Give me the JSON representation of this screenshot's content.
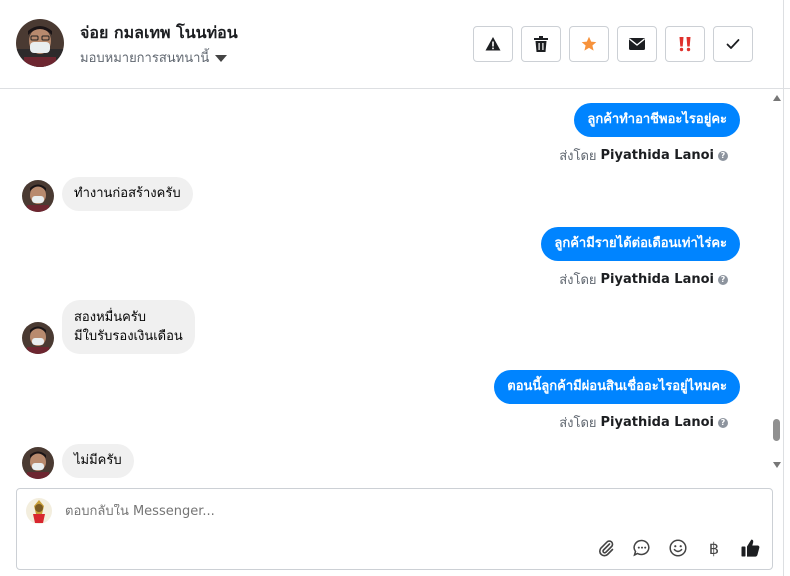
{
  "contact": {
    "name": "จ่อย กมลเทพ โนนท่อน",
    "assign_label": "มอบหมายการสนทนานี้"
  },
  "toolbar": [
    "alert-icon",
    "trash-icon",
    "star-icon",
    "envelope-icon",
    "important-icon",
    "check-icon"
  ],
  "colors": {
    "accent": "#0084ff",
    "star": "#f7923b",
    "important": "#e0312c"
  },
  "messages": {
    "out1": "ลูกค้าทำอาชีพอะไรอยู่คะ",
    "in1": "ทำงานก่อสร้างครับ",
    "out2": "ลูกค้ามีรายได้ต่อเดือนเท่าไร่คะ",
    "in2_line1": "สองหมื่นครับ",
    "in2_line2": "มีใบรับรองเงินเดือน",
    "out3": "ตอนนี้ลูกค้ามีผ่อนสินเชื่ออะไรอยู่ไหมคะ",
    "in3": "ไม่มีครับ"
  },
  "sent_by": {
    "prefix": "ส่งโดย",
    "agent": "Piyathida Lanoi"
  },
  "composer": {
    "placeholder": "ตอบกลับใน Messenger...",
    "currency_symbol": "฿"
  }
}
